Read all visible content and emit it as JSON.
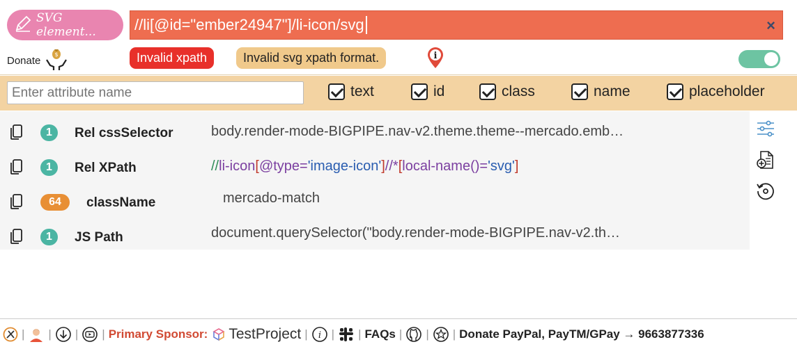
{
  "header": {
    "svg_button_label": "SVG element...",
    "xpath_value": "//li[@id=\"ember24947\"]/li-icon/svg",
    "clear_symbol": "×",
    "donate_label": "Donate",
    "error_badge": "Invalid xpath",
    "warning_badge": "Invalid svg xpath format.",
    "info_symbol": "i",
    "toggle_on": true
  },
  "attributes": {
    "input_placeholder": "Enter attribute name",
    "checkboxes": [
      {
        "label": "text",
        "checked": true
      },
      {
        "label": "id",
        "checked": true
      },
      {
        "label": "class",
        "checked": true
      },
      {
        "label": "name",
        "checked": true
      },
      {
        "label": "placeholder",
        "checked": true
      }
    ]
  },
  "results": [
    {
      "count": "1",
      "name": "Rel cssSelector",
      "value": "body.render-mode-BIGPIPE.nav-v2.theme.theme--mercado.emb…"
    },
    {
      "count": "1",
      "name": "Rel XPath",
      "value_parts": [
        "//",
        "li-icon",
        "[",
        "@type=",
        "'image-icon'",
        "]",
        "//",
        "*",
        "[",
        "local-name()=",
        "'svg'",
        "]"
      ]
    },
    {
      "count": "64",
      "name": "className",
      "value": "mercado-match"
    },
    {
      "count": "1",
      "name": "JS Path",
      "value": "document.querySelector(\"body.render-mode-BIGPIPE.nav-v2.th…"
    }
  ],
  "footer": {
    "primary_sponsor_label": "Primary Sponsor:",
    "sponsor_name": "TestProject",
    "faqs": "FAQs",
    "donate_text": "Donate PayPal, PayTM/GPay → 9663877336",
    "separator": "|"
  },
  "colors": {
    "xpath_bg": "#ee6d50",
    "svg_button": "#e985b0",
    "error": "#e8302a",
    "warning": "#f0c98b",
    "attr_bar": "#f3d3a2",
    "teal": "#4bb5a3",
    "orange": "#e88f35"
  }
}
